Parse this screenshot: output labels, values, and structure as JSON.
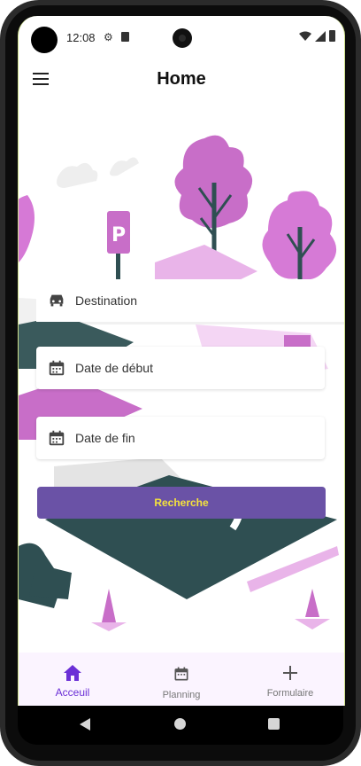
{
  "status": {
    "time": "12:08"
  },
  "app": {
    "title": "Home"
  },
  "form": {
    "destination_placeholder": "Destination",
    "start_date_placeholder": "Date de début",
    "end_date_placeholder": "Date de fin",
    "search_label": "Recherche"
  },
  "bottom_nav": {
    "items": [
      {
        "label": "Acceuil",
        "icon": "home-icon",
        "active": true
      },
      {
        "label": "Planning",
        "icon": "calendar-icon",
        "active": false
      },
      {
        "label": "Formulaire",
        "icon": "plus-icon",
        "active": false
      }
    ]
  },
  "colors": {
    "accent": "#6b2fd6",
    "button_bg": "#6a52a6",
    "button_text": "#f5e33c",
    "nav_bg": "#fbf4ff",
    "illustration_pink": "#d679d6",
    "illustration_dark": "#2f4f52"
  }
}
